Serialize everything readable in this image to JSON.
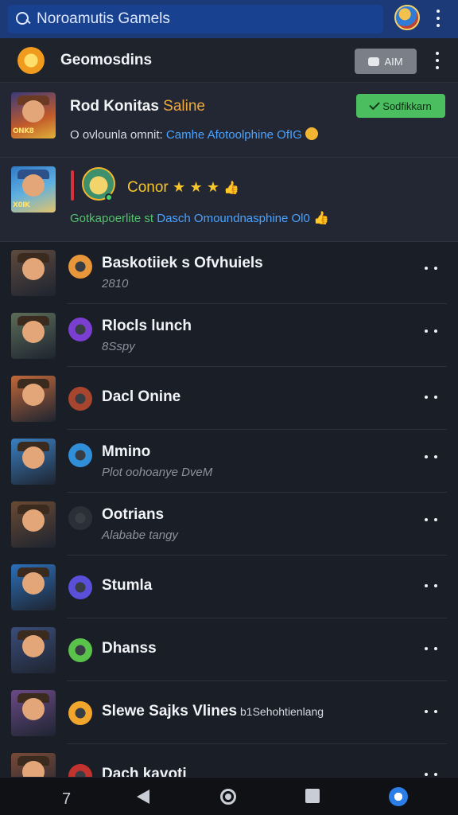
{
  "topbar": {
    "search_text": "Noroamutis Gamels"
  },
  "header": {
    "title": "Geomosdins",
    "aim_button_label": "AIM"
  },
  "featured": [
    {
      "title": "Rod Konitas",
      "title_accent": "Saline",
      "button_label": "Sodfikkarn",
      "subtitle_start": "O ovlounla omnit:",
      "subtitle_link": "Camhe Afotoolphine OfIG",
      "thumb_tag": "ONK8"
    },
    {
      "title": "Conor",
      "subtitle_status": "Gotkapoerlite st",
      "subtitle_link": "Dasch Omoundnasphine Ol0",
      "thumb_tag": "X0IK"
    }
  ],
  "games": [
    {
      "name": "Baskotiiek s Ofvhuiels",
      "meta": "2810",
      "icon_color": "#e8963a",
      "thumb_bg": "#5e4a3d"
    },
    {
      "name": "Rlocls lunch",
      "meta": "8Sspy",
      "icon_color": "#7a3fd1",
      "thumb_bg": "#5c6d58"
    },
    {
      "name": "Dacl Onine",
      "meta": "",
      "icon_color": "#a8452e",
      "thumb_bg": "#c0683a"
    },
    {
      "name": "Mmino",
      "meta": "Plot oohoanye DveM",
      "icon_color": "#2f8fd8",
      "thumb_bg": "#3a7fc0"
    },
    {
      "name": "Ootrians",
      "meta": "Alababe tangy",
      "icon_color": "#2b2f38",
      "thumb_bg": "#6a4a32"
    },
    {
      "name": "Stumla",
      "meta": "",
      "icon_color": "#5a4fd8",
      "thumb_bg": "#2b6fb8"
    },
    {
      "name": "Dhanss",
      "meta": "",
      "icon_color": "#58c24a",
      "thumb_bg": "#3a4d7a"
    },
    {
      "name": "Slewe Sajks Vlines",
      "meta": "",
      "extra": "b1Sehohtienlang",
      "icon_color": "#f2a52c",
      "thumb_bg": "#6b4a86"
    },
    {
      "name": "Dach kavoti",
      "meta": "",
      "icon_color": "#c2332f",
      "thumb_bg": "#7a4a38"
    }
  ],
  "nav": {
    "slash_glyph": "7"
  },
  "colors": {
    "topbar": "#1d3a78",
    "accent_green": "#4bbf5f",
    "link_blue": "#4aa3ff",
    "accent_orange": "#f2a93b"
  },
  "icons": [
    "search-icon",
    "profile-avatar-icon",
    "more-vert-icon",
    "app-logo-icon",
    "camera-icon",
    "check-icon",
    "star-icon",
    "thumbs-up-icon",
    "coin-icon",
    "more-horiz-icon",
    "nav-back-icon",
    "nav-home-icon",
    "nav-recent-icon"
  ]
}
